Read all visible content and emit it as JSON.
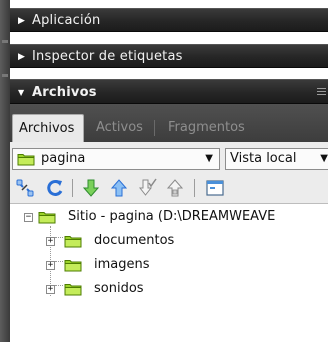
{
  "panels": {
    "aplicacion": {
      "label": "Aplicación"
    },
    "inspector": {
      "label": "Inspector de etiquetas"
    },
    "archivos": {
      "label": "Archivos"
    }
  },
  "tabs": [
    {
      "label": "Archivos",
      "active": true
    },
    {
      "label": "Activos",
      "active": false
    },
    {
      "label": "Fragmentos",
      "active": false
    }
  ],
  "site_select": {
    "value": "pagina"
  },
  "view_select": {
    "value": "Vista local"
  },
  "toolbar": {
    "icons": [
      "connect-icon",
      "refresh-icon",
      "get-files-icon",
      "put-files-icon",
      "check-out-icon",
      "check-in-icon",
      "expand-view-icon"
    ]
  },
  "tree": {
    "root": {
      "label": "Sitio - pagina (D:\\DREAMWEAVE",
      "expander": "−"
    },
    "children": [
      {
        "label": "documentos",
        "expander": "+"
      },
      {
        "label": "imagens",
        "expander": "+"
      },
      {
        "label": "sonidos",
        "expander": "+"
      }
    ]
  },
  "colors": {
    "panel_bar": "#262626",
    "folder": "#7ab800",
    "accent_blue": "#2a6fd6",
    "accent_green": "#2e9e2e"
  }
}
